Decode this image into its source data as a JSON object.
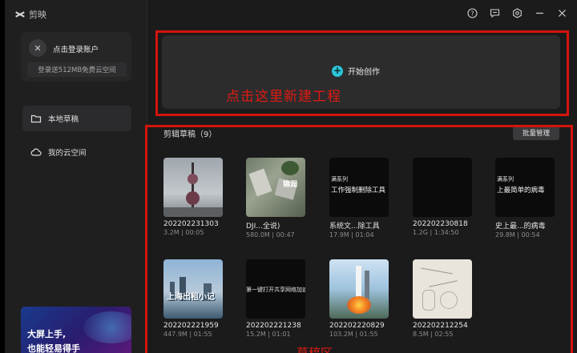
{
  "app": {
    "title": "剪映"
  },
  "sidebar": {
    "login": {
      "label": "点击登录账户",
      "sub": "登录送512MB免费云空间"
    },
    "nav": [
      {
        "label": "本地草稿",
        "icon": "folder-icon"
      },
      {
        "label": "我的云空间",
        "icon": "cloud-icon"
      }
    ],
    "promo": {
      "line1": "大屏上手,",
      "line2": "也能轻易得手"
    }
  },
  "titlebar": {
    "icons": [
      "help-icon",
      "feedback-icon",
      "settings-icon",
      "minimize-icon",
      "close-icon"
    ]
  },
  "create": {
    "label": "开始创作",
    "annotation": "点击这里新建工程"
  },
  "drafts": {
    "title": "剪辑草稿（9）",
    "batch_label": "批量管理",
    "annotation": "草稿区",
    "items": [
      {
        "name": "202202231303",
        "meta": "3.2M | 00:05"
      },
      {
        "name": "DJI...全说)",
        "meta": "580.0M | 00:47",
        "thumb_text": "锦润"
      },
      {
        "name": "系统文...除工具",
        "meta": "17.9M | 01:04",
        "thumb_text_1": "满系列",
        "thumb_text_2": "工作强制删除工具"
      },
      {
        "name": "202202230818",
        "meta": "1.2G | 1:34:50"
      },
      {
        "name": "史上最...的病毒",
        "meta": "29.8M | 00:54",
        "thumb_text_1": "满系列",
        "thumb_text_2": "上最简单的病毒"
      },
      {
        "name": "202202221959",
        "meta": "447.9M | 01:55",
        "thumb_text": "上海出租小记"
      },
      {
        "name": "202202221238",
        "meta": "15.2M | 01:01",
        "thumb_text": "第一键打开共享网络加速"
      },
      {
        "name": "202202220829",
        "meta": "103.2M | 01:55"
      },
      {
        "name": "202202212254",
        "meta": "8.5M | 02:55"
      }
    ]
  }
}
